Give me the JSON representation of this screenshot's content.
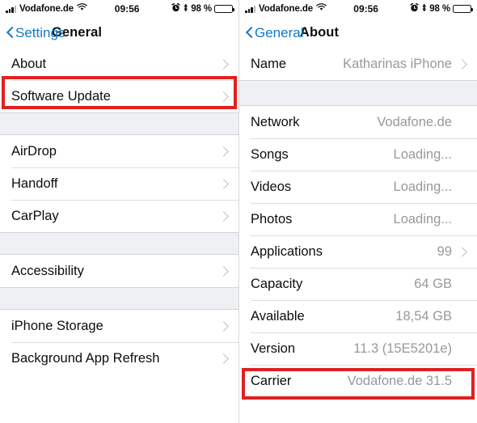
{
  "left_screen": {
    "status_bar": {
      "signal_icon": "signal-bars-icon",
      "carrier": "Vodafone.de",
      "wifi_icon": "wifi-icon",
      "time": "09:56",
      "alarm_icon": "alarm-clock-icon",
      "bluetooth_icon": "bluetooth-icon",
      "battery_percent": "98 %",
      "battery_icon": "battery-full-icon"
    },
    "nav": {
      "back_label": "Settings",
      "back_icon": "chevron-left-icon",
      "title": "General"
    },
    "groups": [
      {
        "rows": [
          {
            "label": "About",
            "value": "",
            "chevron": true,
            "highlighted": true
          },
          {
            "label": "Software Update",
            "value": "",
            "chevron": true,
            "highlighted": false
          }
        ]
      },
      {
        "rows": [
          {
            "label": "AirDrop",
            "value": "",
            "chevron": true,
            "highlighted": false
          },
          {
            "label": "Handoff",
            "value": "",
            "chevron": true,
            "highlighted": false
          },
          {
            "label": "CarPlay",
            "value": "",
            "chevron": true,
            "highlighted": false
          }
        ]
      },
      {
        "rows": [
          {
            "label": "Accessibility",
            "value": "",
            "chevron": true,
            "highlighted": false
          }
        ]
      },
      {
        "rows": [
          {
            "label": "iPhone Storage",
            "value": "",
            "chevron": true,
            "highlighted": false
          },
          {
            "label": "Background App Refresh",
            "value": "",
            "chevron": true,
            "highlighted": false
          }
        ]
      }
    ]
  },
  "right_screen": {
    "status_bar": {
      "signal_icon": "signal-bars-icon",
      "carrier": "Vodafone.de",
      "wifi_icon": "wifi-icon",
      "time": "09:56",
      "alarm_icon": "alarm-clock-icon",
      "bluetooth_icon": "bluetooth-icon",
      "battery_percent": "98 %",
      "battery_icon": "battery-full-icon"
    },
    "nav": {
      "back_label": "General",
      "back_icon": "chevron-left-icon",
      "title": "About"
    },
    "groups": [
      {
        "rows": [
          {
            "label": "Name",
            "value": "Katharinas iPhone",
            "chevron": true,
            "highlighted": false
          }
        ]
      },
      {
        "rows": [
          {
            "label": "Network",
            "value": "Vodafone.de",
            "chevron": false,
            "highlighted": false
          },
          {
            "label": "Songs",
            "value": "Loading...",
            "chevron": false,
            "highlighted": false
          },
          {
            "label": "Videos",
            "value": "Loading...",
            "chevron": false,
            "highlighted": false
          },
          {
            "label": "Photos",
            "value": "Loading...",
            "chevron": false,
            "highlighted": false
          },
          {
            "label": "Applications",
            "value": "99",
            "chevron": true,
            "highlighted": false
          },
          {
            "label": "Capacity",
            "value": "64 GB",
            "chevron": false,
            "highlighted": false
          },
          {
            "label": "Available",
            "value": "18,54 GB",
            "chevron": false,
            "highlighted": false
          },
          {
            "label": "Version",
            "value": "11.3 (15E5201e)",
            "chevron": false,
            "highlighted": true
          },
          {
            "label": "Carrier",
            "value": "Vodafone.de 31.5",
            "chevron": false,
            "highlighted": false
          }
        ]
      }
    ]
  },
  "colors": {
    "accent_blue": "#0f7ac7",
    "highlight_red": "#e02020",
    "value_gray": "#98989e",
    "group_gap": "#eff0f3"
  }
}
